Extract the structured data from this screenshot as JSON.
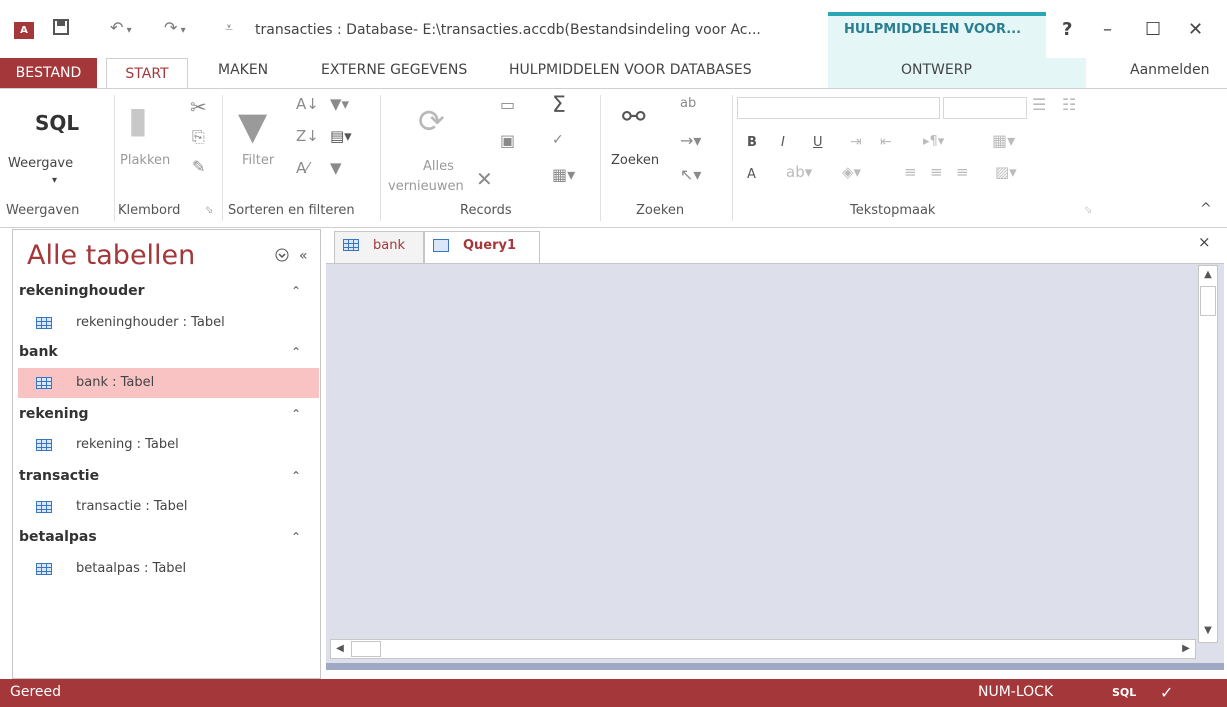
{
  "title_bar": {
    "app_icon_text": "A",
    "save_icon": "save-icon",
    "undo_icon": "undo-icon",
    "redo_icon": "redo-icon",
    "customize_icon": "customize-qat-icon",
    "title": "transacties : Database- E:\\transacties.accdb(Bestandsindeling voor Ac...",
    "context_header": "HULPMIDDELEN VOOR...",
    "help": "?",
    "minimize": "–",
    "maximize": "☐",
    "close": "✕"
  },
  "tabs": {
    "file": "BESTAND",
    "start": "START",
    "create": "MAKEN",
    "external": "EXTERNE GEGEVENS",
    "tools": "HULPMIDDELEN VOOR DATABASES",
    "design": "ONTWERP",
    "signin": "Aanmelden"
  },
  "ribbon": {
    "views": {
      "sql": "SQL",
      "label": "Weergave",
      "dropdown": "▾",
      "group": "Weergaven"
    },
    "clipboard": {
      "paste": "Plakken",
      "group": "Klembord"
    },
    "sort": {
      "filter": "Filter",
      "group": "Sorteren en filteren"
    },
    "records": {
      "refresh_line1": "Alles",
      "refresh_line2": "vernieuwen",
      "group": "Records"
    },
    "find": {
      "find": "Zoeken",
      "group": "Zoeken"
    },
    "text": {
      "bold": "B",
      "italic": "I",
      "underline": "U",
      "font_color": "A",
      "group": "Tekstopmaak"
    },
    "collapse": "^"
  },
  "nav": {
    "title": "Alle tabellen",
    "menu_icon": "⌄",
    "collapse": "«",
    "groups": [
      {
        "header": "rekeninghouder",
        "item": "rekeninghouder : Tabel"
      },
      {
        "header": "bank",
        "item": "bank : Tabel"
      },
      {
        "header": "rekening",
        "item": "rekening : Tabel"
      },
      {
        "header": "transactie",
        "item": "transactie : Tabel"
      },
      {
        "header": "betaalpas",
        "item": "betaalpas : Tabel"
      }
    ],
    "chevron": "⌃"
  },
  "document": {
    "tabs": [
      {
        "label": "bank"
      },
      {
        "label": "Query1"
      }
    ],
    "close": "×"
  },
  "status": {
    "ready": "Gereed",
    "numlock": "NUM-LOCK",
    "sql": "SQL",
    "design_icon": "design-view-icon"
  },
  "colors": {
    "accent": "#a4373a",
    "context": "#2ba6b4",
    "selected_row": "#f9c3c4"
  }
}
